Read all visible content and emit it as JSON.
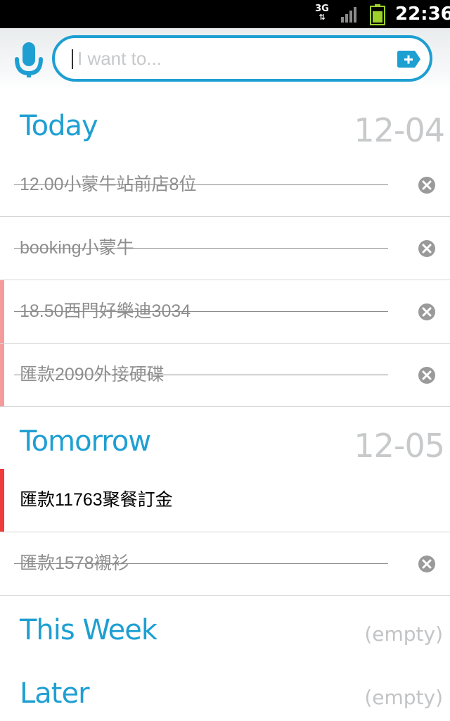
{
  "status_bar": {
    "network": "3G",
    "time": "22:36"
  },
  "search": {
    "placeholder": "I want to..."
  },
  "sections": {
    "today": {
      "title": "Today",
      "date": "12-04"
    },
    "tomorrow": {
      "title": "Tomorrow",
      "date": "12-05"
    },
    "this_week": {
      "title": "This Week",
      "status": "(empty)"
    },
    "later": {
      "title": "Later",
      "status": "(empty)"
    }
  },
  "tasks": {
    "today": [
      {
        "text": "12.00小蒙牛站前店8位",
        "done": true,
        "marker": null
      },
      {
        "text": "booking小蒙牛",
        "done": true,
        "marker": null
      },
      {
        "text": "18.50西門好樂迪3034",
        "done": true,
        "marker": "#f59b9b"
      },
      {
        "text": "匯款2090外接硬碟",
        "done": true,
        "marker": "#f59b9b"
      }
    ],
    "tomorrow": [
      {
        "text": "匯款11763聚餐訂金",
        "done": false,
        "marker": "#ee3b3b"
      },
      {
        "text": "匯款1578襯衫",
        "done": true,
        "marker": null
      }
    ]
  },
  "colors": {
    "accent": "#1e9fd2",
    "date_gray": "#c7c9cb",
    "marker_light": "#f59b9b",
    "marker_strong": "#ee3b3b"
  }
}
